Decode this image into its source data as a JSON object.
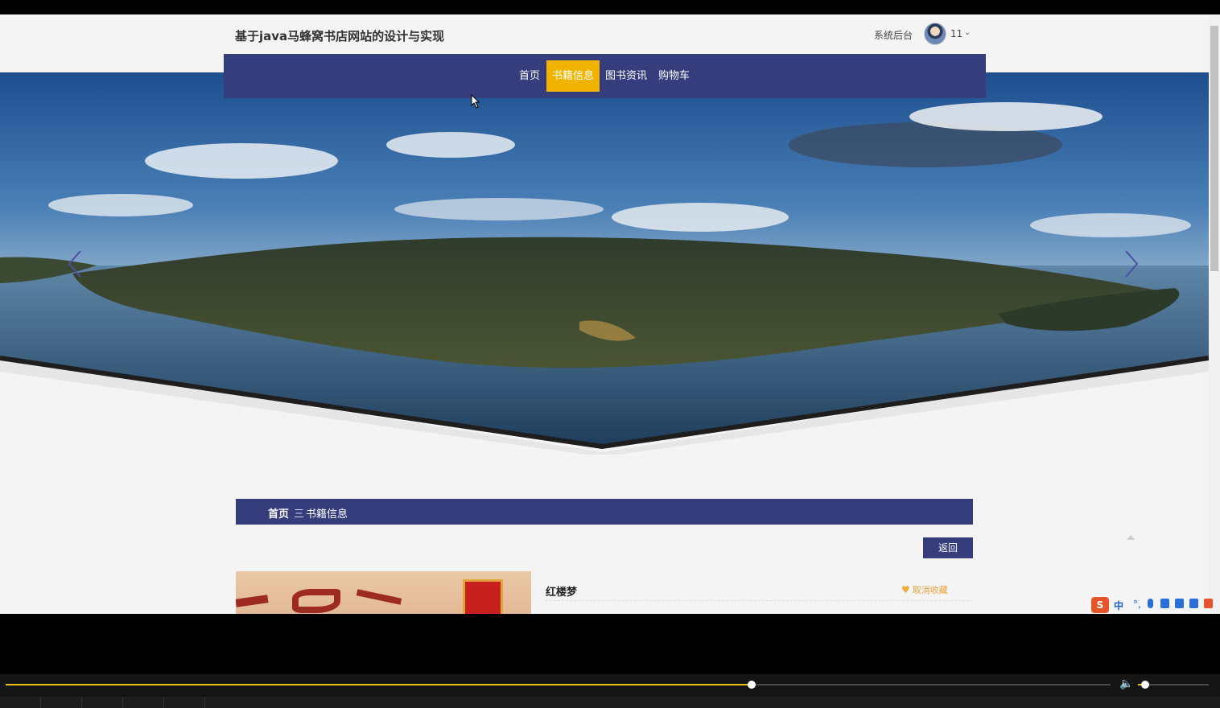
{
  "header": {
    "site_title": "基于java马蜂窝书店网站的设计与实现",
    "admin_link": "系统后台",
    "user_name": "11"
  },
  "nav": {
    "items": [
      "首页",
      "书籍信息",
      "图书资讯",
      "购物车"
    ],
    "active_index": 1
  },
  "breadcrumb": {
    "home": "首页",
    "separator": "三",
    "current": "书籍信息"
  },
  "detail": {
    "back_label": "返回",
    "book_title": "红楼梦",
    "favorite_label": "取消收藏"
  },
  "ime": {
    "lang": "中"
  },
  "player": {
    "progress": 0.675,
    "volume": 0.1
  },
  "colors": {
    "brand": "#353d7c",
    "accent": "#f0b400",
    "favorite": "#e8a33a"
  }
}
